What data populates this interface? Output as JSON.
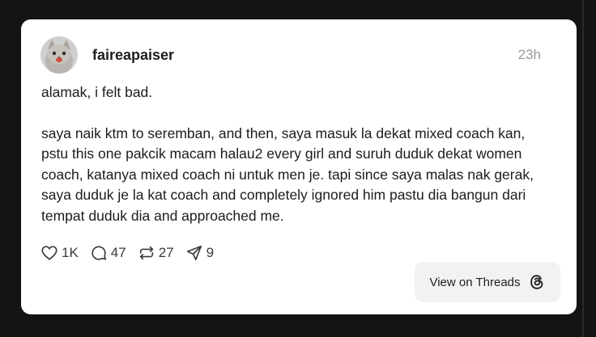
{
  "post": {
    "username": "faireapaiser",
    "timestamp": "23h",
    "avatar_icon": "cat-avatar",
    "paragraphs": [
      "alamak, i felt bad.",
      "saya naik ktm to seremban, and then, saya masuk la dekat mixed coach kan, pstu this one pakcik macam halau2 every girl and suruh duduk dekat women coach, katanya mixed coach ni untuk men je. tapi since saya malas nak gerak, saya duduk je la kat coach and completely ignored him pastu dia bangun dari tempat duduk dia and approached me."
    ]
  },
  "actions": {
    "likes": {
      "icon": "heart-icon",
      "count": "1K"
    },
    "replies": {
      "icon": "comment-icon",
      "count": "47"
    },
    "reposts": {
      "icon": "repost-icon",
      "count": "27"
    },
    "shares": {
      "icon": "send-icon",
      "count": "9"
    }
  },
  "view_button": {
    "label": "View on Threads",
    "icon": "threads-icon"
  },
  "colors": {
    "page_background": "#141414",
    "card_background": "#ffffff",
    "button_background": "#f2f2f2",
    "muted_text": "#9a9a9a"
  }
}
